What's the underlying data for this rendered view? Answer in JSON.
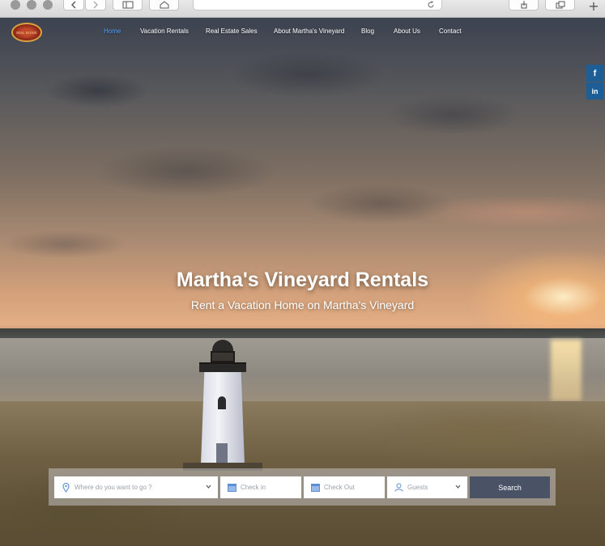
{
  "nav": {
    "logo_text": "REAL ESTATE",
    "items": [
      {
        "label": "Home",
        "active": true
      },
      {
        "label": "Vacation Rentals",
        "active": false
      },
      {
        "label": "Real Estate Sales",
        "active": false
      },
      {
        "label": "About Martha's Vineyard",
        "active": false
      },
      {
        "label": "Blog",
        "active": false
      },
      {
        "label": "About Us",
        "active": false
      },
      {
        "label": "Contact",
        "active": false
      }
    ]
  },
  "social": {
    "facebook": "f",
    "linkedin": "in"
  },
  "hero": {
    "title": "Martha's Vineyard Rentals",
    "subtitle": "Rent a Vacation Home on Martha's Vineyard"
  },
  "search": {
    "where_placeholder": "Where do you want to go ?",
    "checkin_placeholder": "Check in",
    "checkout_placeholder": "Check Out",
    "guests_placeholder": "Guests",
    "button_label": "Search"
  },
  "colors": {
    "nav_active": "#4da3ff",
    "search_button": "#4a5366",
    "social": "#1d5e97"
  }
}
